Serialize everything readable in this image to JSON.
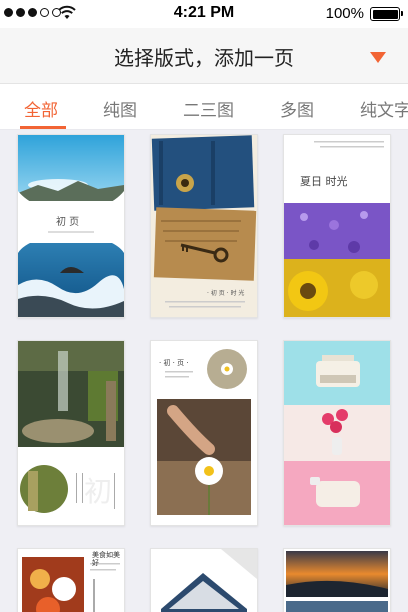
{
  "status_bar": {
    "time": "4:21 PM",
    "battery": "100%",
    "signal_filled": 3,
    "signal_total": 5,
    "icons": [
      "signal-dots-icon",
      "wifi-icon",
      "battery-icon"
    ]
  },
  "header": {
    "title": "选择版式，添加一页",
    "dropdown_icon": "caret-down-icon"
  },
  "tabs": [
    {
      "label": "全部",
      "active": true
    },
    {
      "label": "纯图",
      "active": false
    },
    {
      "label": "二三图",
      "active": false
    },
    {
      "label": "多图",
      "active": false
    },
    {
      "label": "纯文字",
      "active": false
    }
  ],
  "colors": {
    "accent": "#f26434",
    "grid_bg": "#efeff4",
    "header_bg": "#f6f6f6"
  },
  "templates": {
    "t1_text": "初 页",
    "t3_text": "夏日 时光",
    "t5_text": "· 初 · 页 ·",
    "t7_text": "美食如美好"
  }
}
